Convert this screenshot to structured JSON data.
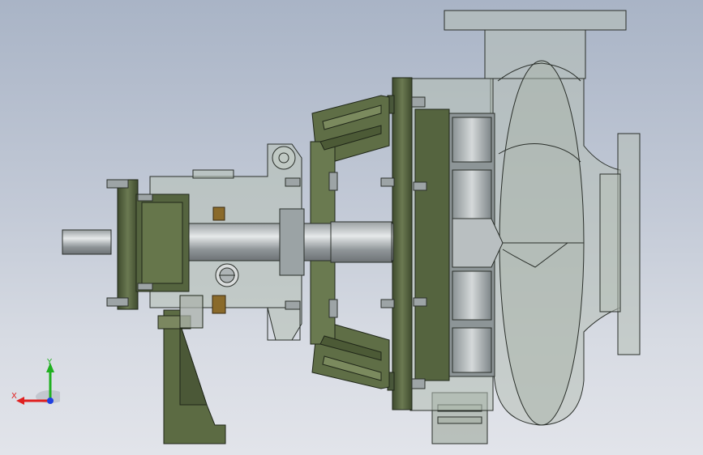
{
  "view": {
    "background_top": "#a9b4c6",
    "background_bottom": "#e2e4ea",
    "part_color_green": "#5c6b46",
    "part_color_dark_green": "#3f4a2e",
    "housing_translucent": "#b9c1b8",
    "edge_color": "#2a2f2a"
  },
  "triad": {
    "x_label": "X",
    "y_label": "Y",
    "x_color": "#e02020",
    "y_color": "#20b020",
    "z_color": "#2040e0"
  }
}
